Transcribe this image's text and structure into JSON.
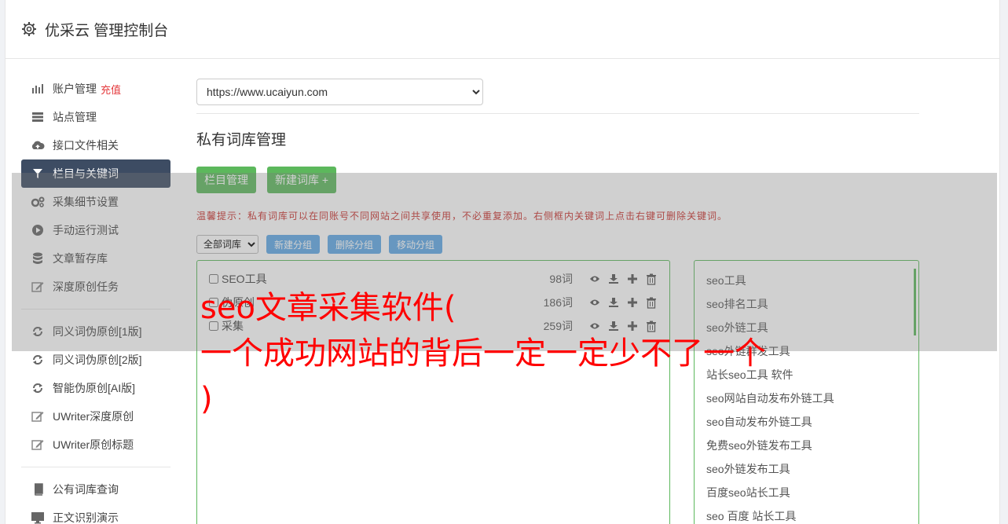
{
  "header": {
    "title": "优采云 管理控制台",
    "icon": "gear-icon"
  },
  "sidebar": {
    "groups": [
      [
        {
          "label": "账户管理",
          "badge": "充值",
          "icon": "bar-chart-icon"
        },
        {
          "label": "站点管理",
          "icon": "server-icon"
        },
        {
          "label": "接口文件相关",
          "icon": "cloud-upload-icon"
        },
        {
          "label": "栏目与关键词",
          "icon": "filter-icon",
          "active": true
        },
        {
          "label": "采集细节设置",
          "icon": "cogs-icon"
        },
        {
          "label": "手动运行测试",
          "icon": "play-icon"
        },
        {
          "label": "文章暂存库",
          "icon": "database-icon"
        },
        {
          "label": "深度原创任务",
          "icon": "edit-icon"
        }
      ],
      [
        {
          "label": "同义词伪原创[1版]",
          "icon": "refresh-icon"
        },
        {
          "label": "同义词伪原创[2版]",
          "icon": "refresh-icon"
        },
        {
          "label": "智能伪原创[AI版]",
          "icon": "refresh-icon"
        },
        {
          "label": "UWriter深度原创",
          "icon": "edit-icon"
        },
        {
          "label": "UWriter原创标题",
          "icon": "edit-icon"
        }
      ],
      [
        {
          "label": "公有词库查询",
          "icon": "book-icon"
        },
        {
          "label": "正文识别演示",
          "icon": "monitor-icon"
        }
      ]
    ]
  },
  "main": {
    "site_select": "https://www.ucaiyun.com",
    "section_title": "私有词库管理",
    "buttons": {
      "column_manage": "栏目管理",
      "new_library": "新建词库 +"
    },
    "tip": "温馨提示：私有词库可以在同账号不同网站之间共享使用，不必重复添加。右侧框内关键词上点击右键可删除关键词。",
    "group_select": "全部词库",
    "group_buttons": {
      "new": "新建分组",
      "delete": "删除分组",
      "move": "移动分组"
    },
    "libraries": [
      {
        "name": "SEO工具",
        "count": "98词"
      },
      {
        "name": "伪原创",
        "count": "186词"
      },
      {
        "name": "采集",
        "count": "259词"
      }
    ],
    "keywords": [
      "seo工具",
      "seo排名工具",
      "seo外链工具",
      "seo外链群发工具",
      "站长seo工具 软件",
      "seo网站自动发布外链工具",
      "seo自动发布外链工具",
      "免费seo外链发布工具",
      "seo外链发布工具",
      "百度seo站长工具",
      "seo 百度 站长工具"
    ]
  },
  "overlay_headline": {
    "line1": "seo文章采集软件(",
    "line2": "一个成功网站的背后一定一定少不了一个",
    "line3": ")"
  },
  "colors": {
    "accent_green": "#5cb85c",
    "accent_blue": "#5fa8e6",
    "active_nav": "#3d4c63",
    "warning_red": "#c9302c",
    "headline_red": "#ff0000"
  }
}
